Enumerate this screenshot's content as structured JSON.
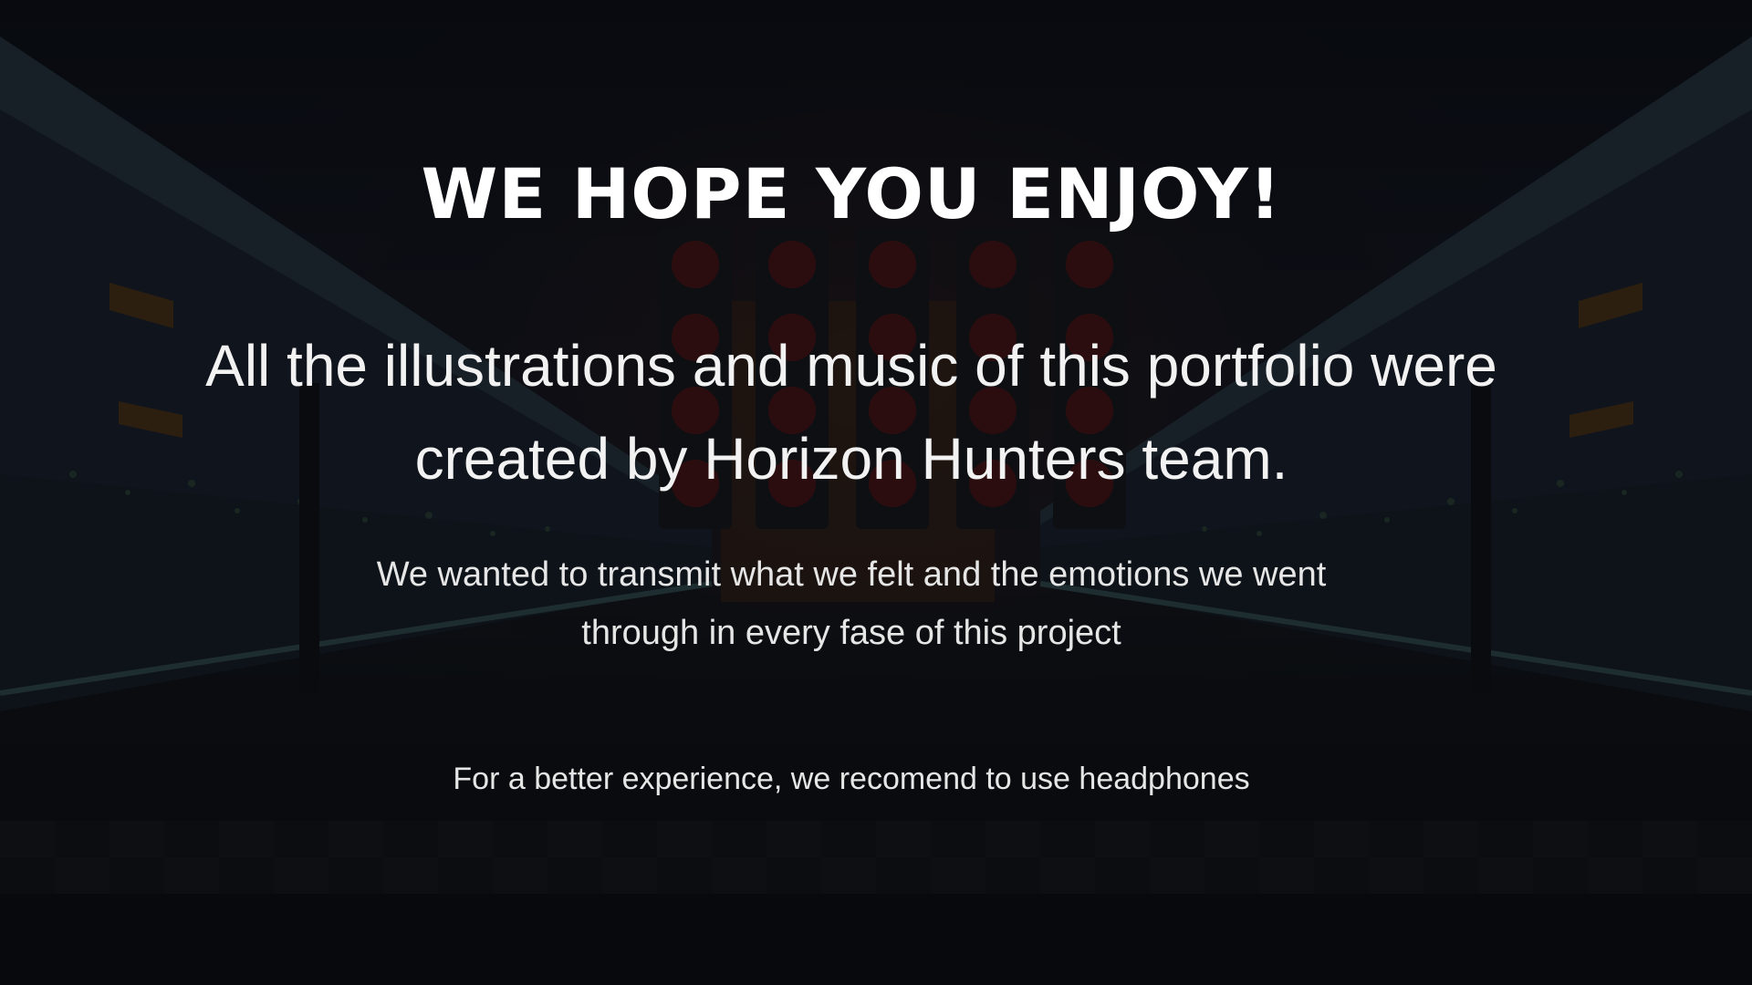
{
  "intro": {
    "headline": "WE HOPE YOU ENJOY!",
    "lead": "All the illustrations and music of this portfolio were created by Horizon Hunters team.",
    "sub": "We wanted to transmit what we felt and the emotions we went through in every fase of this project",
    "note": "For a better experience, we recomend to use headphones"
  },
  "theme": {
    "text_color": "#ffffff",
    "background": "#0b0c10",
    "light_color": "#8b1a1a"
  }
}
